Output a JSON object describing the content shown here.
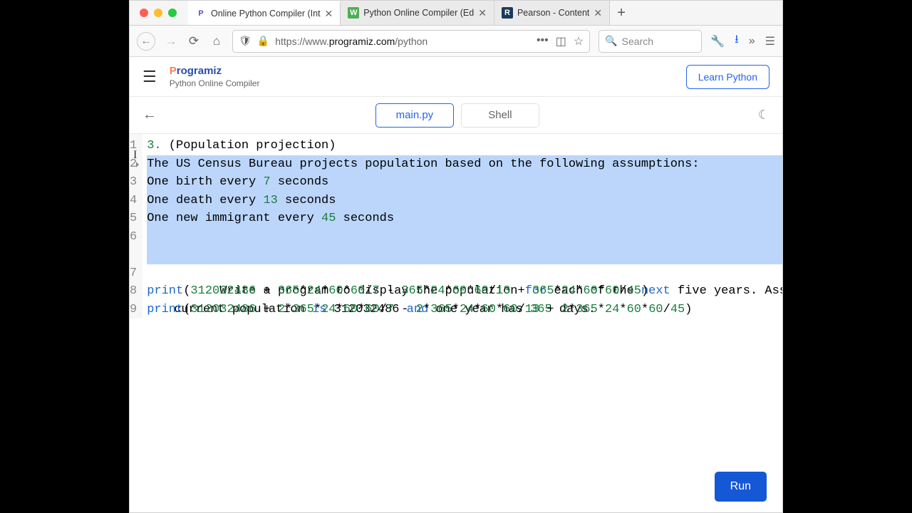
{
  "browser": {
    "tabs": [
      {
        "label": "Online Python Compiler (Int"
      },
      {
        "label": "Python Online Compiler (Ed"
      },
      {
        "label": "Pearson - Content"
      }
    ],
    "url_prefix": "https://www.",
    "url_host": "programiz.com",
    "url_path": "/python",
    "search_placeholder": "Search"
  },
  "header": {
    "brand": "Programiz",
    "subtitle": "Python Online Compiler",
    "learn_button": "Learn Python"
  },
  "filetabs": {
    "active": "main.py",
    "other": "Shell"
  },
  "code": {
    "line1_a": "3.",
    "line1_b": " (Population projection)",
    "line2": "The US Census Bureau projects population based on the following assumptions:",
    "line3_a": "One birth every ",
    "line3_b": "7",
    "line3_c": " seconds",
    "line4_a": "One death every ",
    "line4_b": "13",
    "line4_c": " seconds",
    "line5_a": "One new immigrant every ",
    "line5_b": "45",
    "line5_c": " seconds",
    "line6_a": "Write a program to display the population ",
    "line6_b": "for",
    "line6_c": " each of the ",
    "line6_d": "next",
    "line6_e": " five years. Assume the ",
    "line6w_a": "current population ",
    "line6w_b": "is",
    "line6w_c": " 312032486 ",
    "line6w_d": "and",
    "line6w_e": " one year has ",
    "line6w_f": "365",
    "line6w_g": " days.",
    "line7": "",
    "line8_a": "print",
    "line8_b": "(",
    "line8_c": "312032486",
    "line8_d": " + ",
    "line8_e": "365",
    "line8_f": "*",
    "line8_g": "24",
    "line8_h": "*",
    "line8_i": "60",
    "line8_j": "*",
    "line8_k": "60",
    "line8_l": "/",
    "line8_m": "7",
    "line8_n": " - ",
    "line8_o": "365",
    "line8_p": "*",
    "line8_q": "24",
    "line8_r": "*",
    "line8_s": "60",
    "line8_t": "*",
    "line8_u": "60",
    "line8_v": "/",
    "line8_w": "13",
    "line8_x": " + ",
    "line8_y": "365",
    "line8_z": "*",
    "line8_aa": "24",
    "line8_ab": "*",
    "line8_ac": "60",
    "line8_ad": "*",
    "line8_ae": "60",
    "line8_af": "/",
    "line8_ag": "45",
    "line8_ah": ")",
    "line9_a": "print",
    "line9_b": "(",
    "line9_c": "312032486",
    "line9_d": " + ",
    "line9_e": "2",
    "line9_f": "*",
    "line9_g": "365",
    "line9_h": "*",
    "line9_i": "24",
    "line9_j": "*",
    "line9_k": "60",
    "line9_l": "*",
    "line9_m": "60",
    "line9_n": "/",
    "line9_o": "7",
    "line9_p": " - ",
    "line9_q": "2",
    "line9_r": "*",
    "line9_s": "365",
    "line9_t": "*",
    "line9_u": "24",
    "line9_v": "*",
    "line9_w": "60",
    "line9_x": "*",
    "line9_y": "60",
    "line9_z": "/",
    "line9_aa": "13",
    "line9_ab": " + ",
    "line9_ac": "2",
    "line9_ad": "*",
    "line9_ae": "365",
    "line9_af": "*",
    "line9_ag": "24",
    "line9_ah": "*",
    "line9_ai": "60",
    "line9_aj": "*",
    "line9_ak": "60",
    "line9_al": "/",
    "line9_am": "45",
    "line9_an": ")"
  },
  "run_button": "Run"
}
